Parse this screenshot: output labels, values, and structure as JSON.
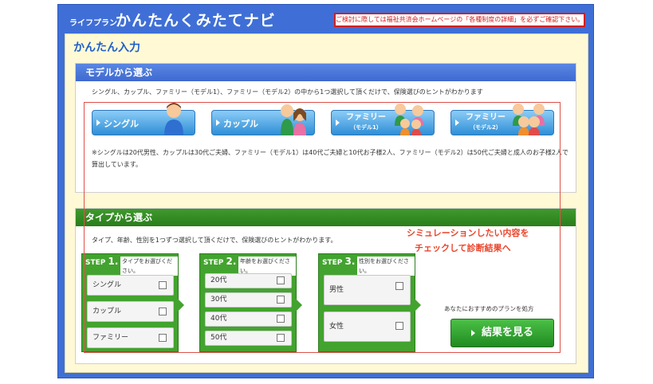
{
  "header": {
    "brand_small": "ライフプラン",
    "brand_big": "かんたんくみたてナビ",
    "notice": "ご検討に際しては福祉共済会ホームページの「各種制度の詳細」を必ずご確認下さい。"
  },
  "section_title": "かんたん入力",
  "model": {
    "heading": "モデルから選ぶ",
    "description": "シングル、カップル、ファミリー（モデル1）、ファミリー（モデル2）の中から1つ選択して頂くだけで、保険選びのヒントがわかります",
    "buttons": [
      {
        "label": "シングル",
        "sub": ""
      },
      {
        "label": "カップル",
        "sub": ""
      },
      {
        "label": "ファミリー",
        "sub": "（モデル1）"
      },
      {
        "label": "ファミリー",
        "sub": "（モデル2）"
      }
    ],
    "note": "※シングルは20代男性、カップルは30代ご夫婦、ファミリー（モデル1）は40代ご夫婦と10代お子様2人、ファミリー（モデル2）は50代ご夫婦と成人のお子様2人で算出しています。"
  },
  "type": {
    "heading": "タイプから選ぶ",
    "description": "タイプ、年齢、性別を1つずつ選択して頂くだけで、保険選びのヒントがわかります。",
    "steps": [
      {
        "badge": "STEP",
        "num": "1.",
        "caption": "タイプをお選びください。",
        "options": [
          "シングル",
          "カップル",
          "ファミリー"
        ]
      },
      {
        "badge": "STEP",
        "num": "2.",
        "caption": "年齢をお選びください。",
        "options": [
          "20代",
          "30代",
          "40代",
          "50代"
        ]
      },
      {
        "badge": "STEP",
        "num": "3.",
        "caption": "性別をお選びください。",
        "options": [
          "男性",
          "女性"
        ]
      }
    ],
    "result_caption": "あなたにおすすめのプランを処方",
    "result_button": "結果を見る"
  },
  "callout": {
    "line1": "シミュレーションしたい内容を",
    "line2": "チェックして診断結果へ"
  },
  "colors": {
    "frame_blue": "#3f6fd6",
    "step_green": "#43a32f",
    "callout_red": "#e8452c"
  }
}
